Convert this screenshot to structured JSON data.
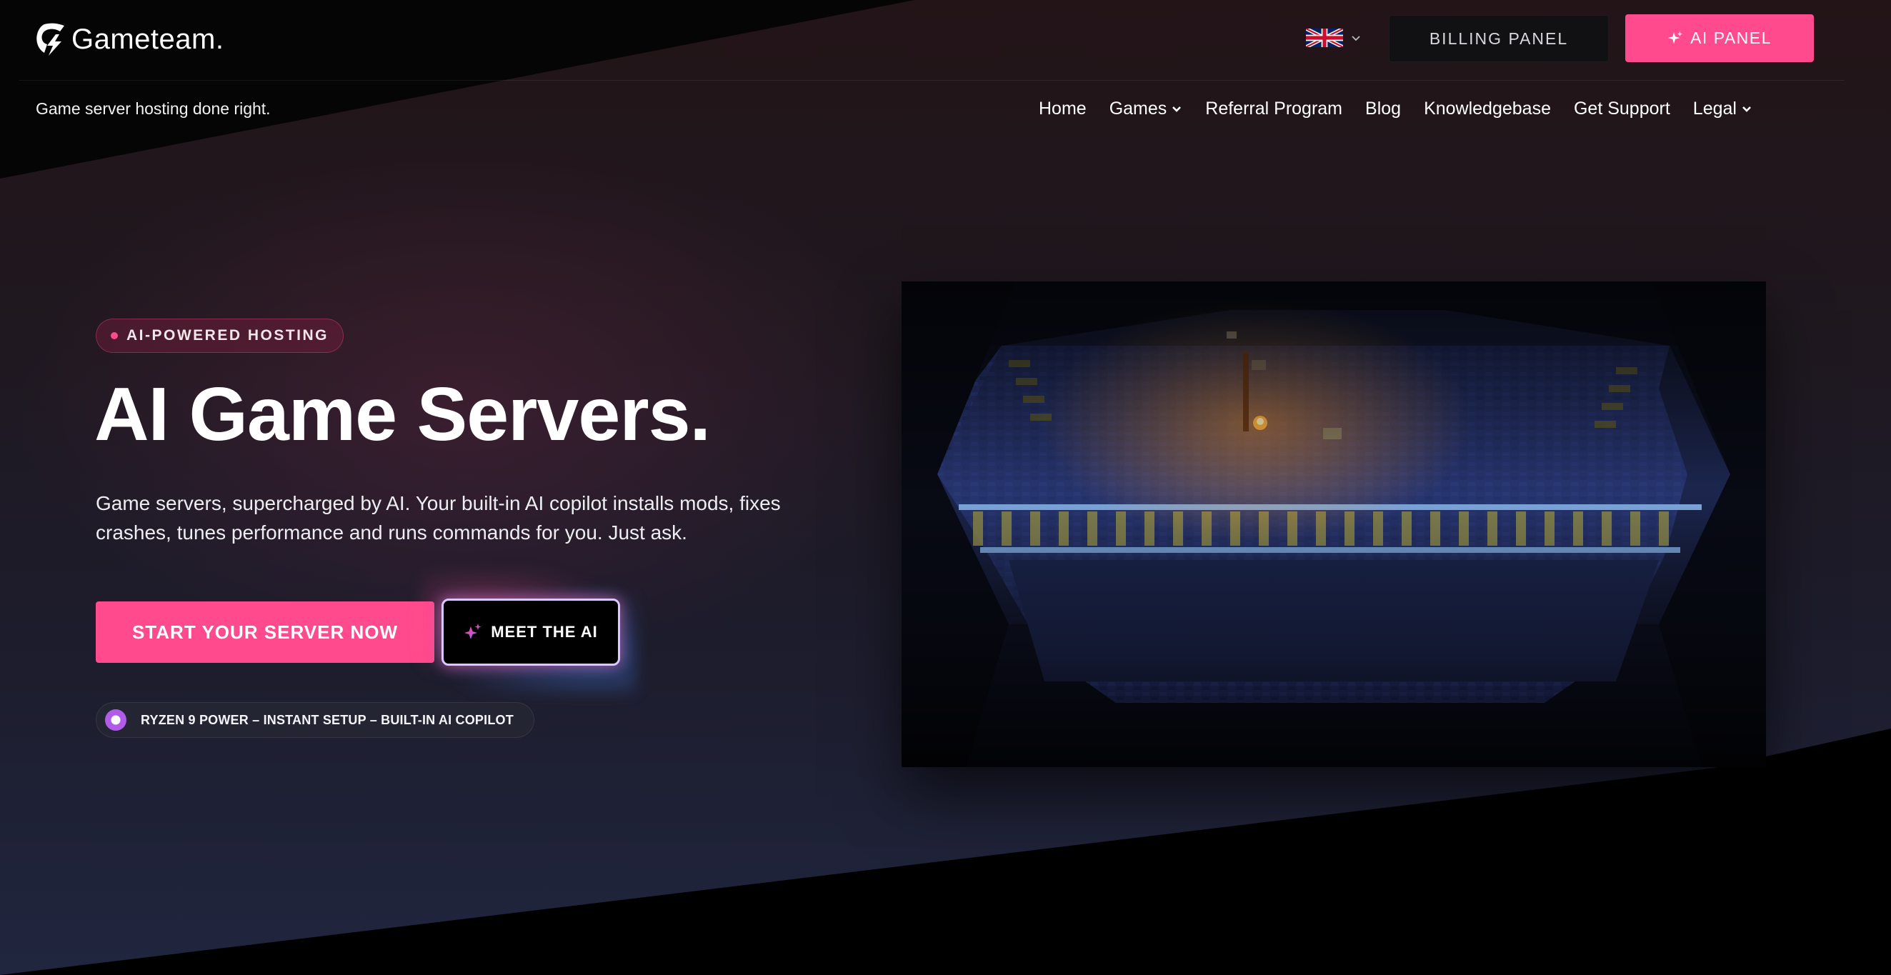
{
  "brand": {
    "name": "Gameteam",
    "dot": ".",
    "tagline": "Game server hosting done right."
  },
  "header": {
    "language_icon": "uk-flag-icon",
    "billing_label": "BILLING PANEL",
    "ai_panel_label": "AI PANEL"
  },
  "nav": {
    "items": [
      {
        "label": "Home"
      },
      {
        "label": "Games"
      },
      {
        "label": "Referral Program"
      },
      {
        "label": "Blog"
      },
      {
        "label": "Knowledgebase"
      },
      {
        "label": "Get Support"
      },
      {
        "label": "Legal"
      }
    ]
  },
  "hero": {
    "badge": "AI-POWERED HOSTING",
    "title": "AI Game Servers.",
    "description": "Game servers, supercharged by AI. Your built-in AI copilot installs mods, fixes crashes, tunes performance and runs commands for you. Just ask.",
    "cta_primary": "START YOUR SERVER NOW",
    "cta_secondary": "MEET THE AI",
    "features": "RYZEN 9 POWER – INSTANT SETUP – BUILT-IN AI COPILOT"
  },
  "colors": {
    "accent": "#ff4a8d",
    "billing_bg": "#111113",
    "pill_dot": "#b05ce8"
  }
}
